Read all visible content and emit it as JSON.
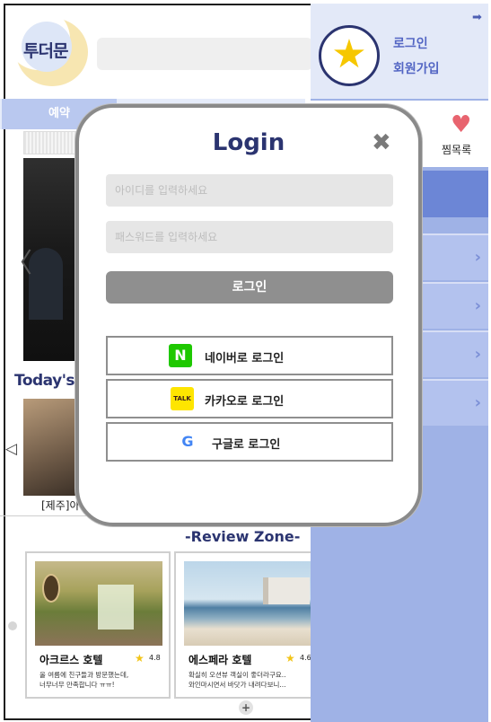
{
  "header": {
    "logo_text": "투더문",
    "nav_tabs": [
      {
        "label": "예약"
      }
    ]
  },
  "banner": {
    "prev_arrow": "〈"
  },
  "todays": {
    "title": "Today's",
    "prev_arrow": "◁",
    "caption": "[제주]아"
  },
  "review_zone": {
    "title": "-Review Zone-",
    "cards": [
      {
        "name": "아크르스 호텔",
        "rating": "4.8",
        "text_lines": [
          "올 여름에 친구들과 방문했는데,",
          "너무너무 만족합니다 ㅠㅠ!"
        ]
      },
      {
        "name": "에스페라 호텔",
        "rating": "4.6",
        "text_lines": [
          "확실히 오션뷰 객실이 좋더라구요..",
          "와인마시면서 바닷가 내려다보니..."
        ]
      }
    ],
    "more_label": "+"
  },
  "side_panel": {
    "exit_icon": "➡",
    "star_icon": "★",
    "login_link": "로그인",
    "signup_link": "회원가입",
    "wishlist_icon": "♥",
    "wishlist_label": "찜목록",
    "chevron": "›"
  },
  "login_modal": {
    "title": "Login",
    "close_icon": "✖",
    "id_placeholder": "아이디를 입력하세요",
    "pw_placeholder": "패스워드를 입력하세요",
    "login_button": "로그인",
    "naver": {
      "icon_text": "N",
      "label": "네이버로 로그인"
    },
    "kakao": {
      "icon_text": "TALK",
      "label": "카카오로 로그인"
    },
    "google": {
      "icon_text": "G",
      "label": "구글로 로그인"
    }
  },
  "colors": {
    "brand_navy": "#2b3470",
    "panel_blue": "#9fb2e6",
    "panel_active": "#6c86d6",
    "star_yellow": "#f6c700",
    "naver_green": "#1ec800",
    "kakao_yellow": "#fee500",
    "heart_red": "#e8646f"
  }
}
